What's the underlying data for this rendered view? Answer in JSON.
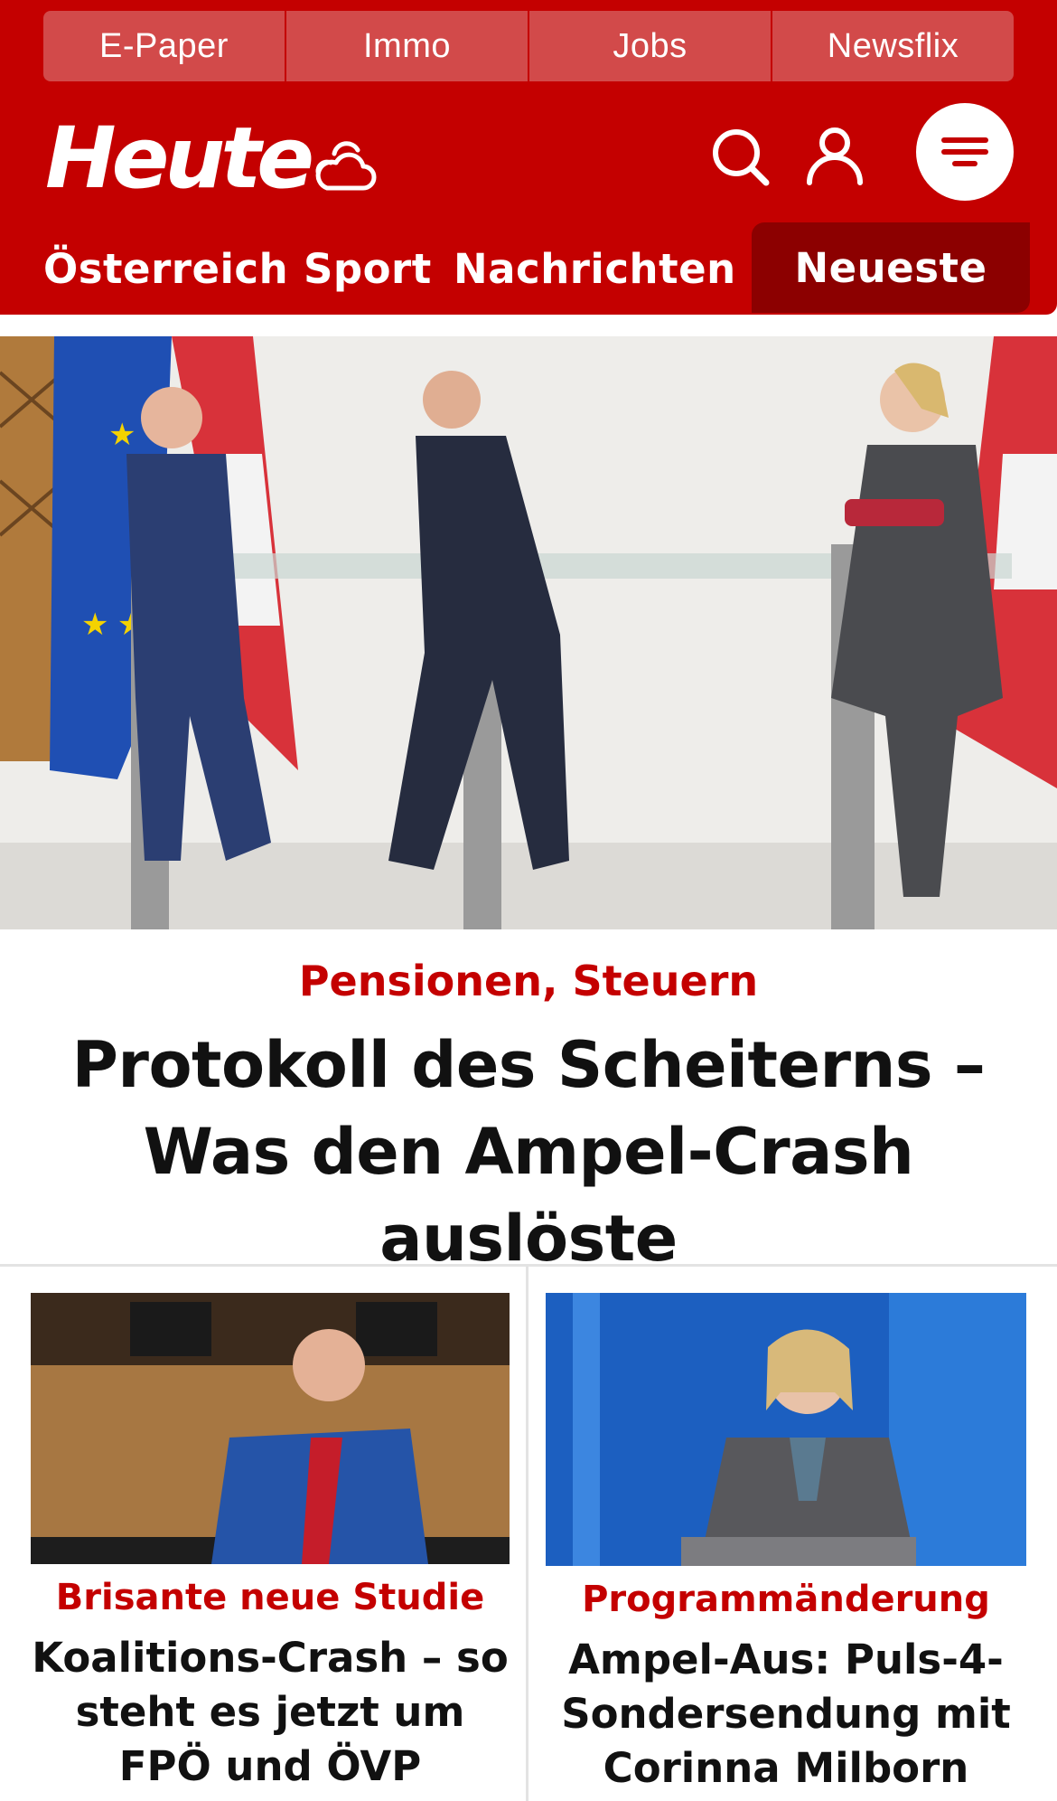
{
  "service_links": [
    "E-Paper",
    "Immo",
    "Jobs",
    "Newsflix"
  ],
  "header": {
    "logo_text": "Heute",
    "icons": [
      "weather-cloud-icon",
      "search-icon",
      "user-icon",
      "menu-icon"
    ]
  },
  "nav": {
    "items": [
      "Österreich",
      "Sport",
      "Nachrichten"
    ],
    "active": "Neueste"
  },
  "hero": {
    "kicker": "Pensionen, Steuern",
    "title": "Protokoll des Scheiterns – Was den Ampel-Crash auslöste"
  },
  "teasers": [
    {
      "kicker": "Brisante neue Studie",
      "title": "Koalitions-Crash – so steht es jetzt um FPÖ und ÖVP"
    },
    {
      "kicker": "Programmänderung",
      "title": "Ampel-Aus: Puls-4-Sondersendung mit Corinna Milborn"
    }
  ],
  "colors": {
    "brand_red": "#c40000",
    "active_tab": "#8c0000",
    "service_link_bg": "#d24a4a",
    "kicker_red": "#c40000"
  }
}
